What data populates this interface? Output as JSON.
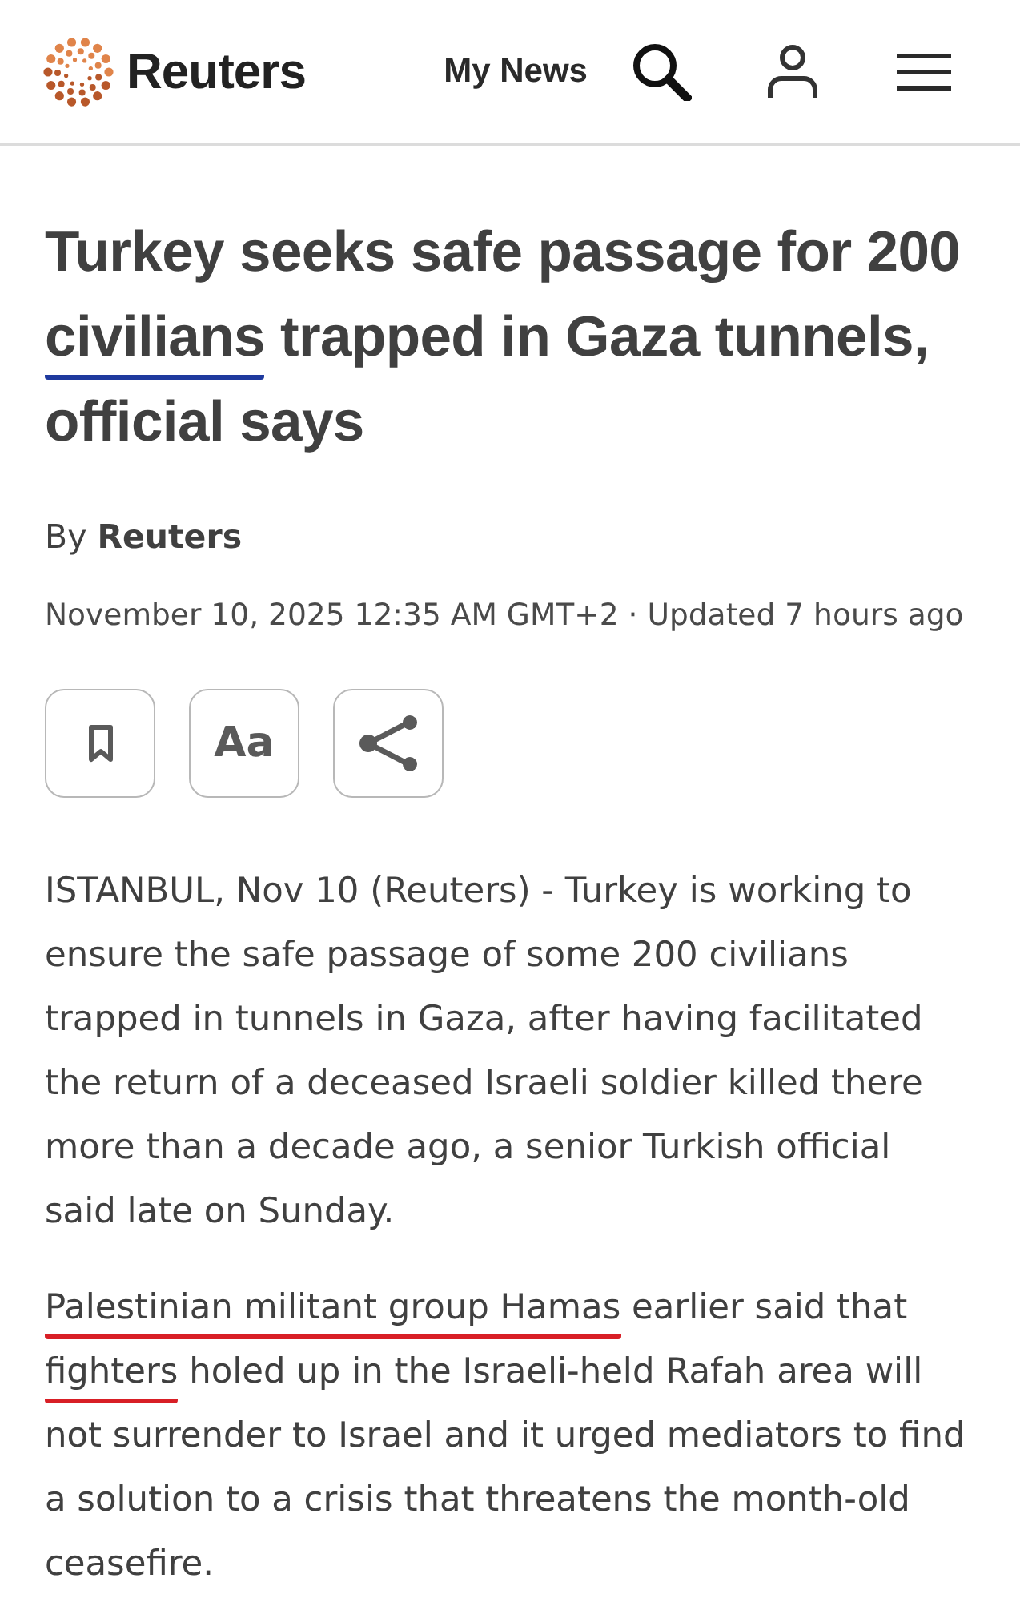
{
  "header": {
    "logo": {
      "wordmark": "Reuters"
    },
    "nav_link": "My News"
  },
  "article": {
    "headline": [
      {
        "text": "Turkey seeks safe passage for 200 "
      },
      {
        "text": "civilians",
        "color": "#1f3a9e"
      },
      {
        "text": " trapped in Gaza tunnels, official says"
      }
    ],
    "byline": "By **Reuters**",
    "timestamp": "November 10, 2025 12:35 AM GMT+2 · Updated 7 hours ago",
    "actions": [
      {
        "kind": "bookmark"
      },
      {
        "kind": "text",
        "label": "Aa"
      },
      {
        "kind": "share"
      }
    ],
    "paragraphs": [
      [
        {
          "text": "ISTANBUL, Nov 10 (Reuters) - Turkey is working to ensure the safe passage of some 200 civilians trapped in tunnels in Gaza, after having facilitated the return of a deceased Israeli soldier killed there more than a decade ago, a senior Turkish official said late on Sunday."
        }
      ],
      [
        {
          "text": "Palestinian militant group Hamas",
          "color": "#d81f26"
        },
        {
          "text": " earlier said that "
        },
        {
          "text": "fighters",
          "color": "#d81f26"
        },
        {
          "text": " holed up in the Israeli-held Rafah area will not surrender to Israel and it urged mediators to find a solution to a crisis that threatens the month-old ceasefire."
        }
      ]
    ]
  }
}
